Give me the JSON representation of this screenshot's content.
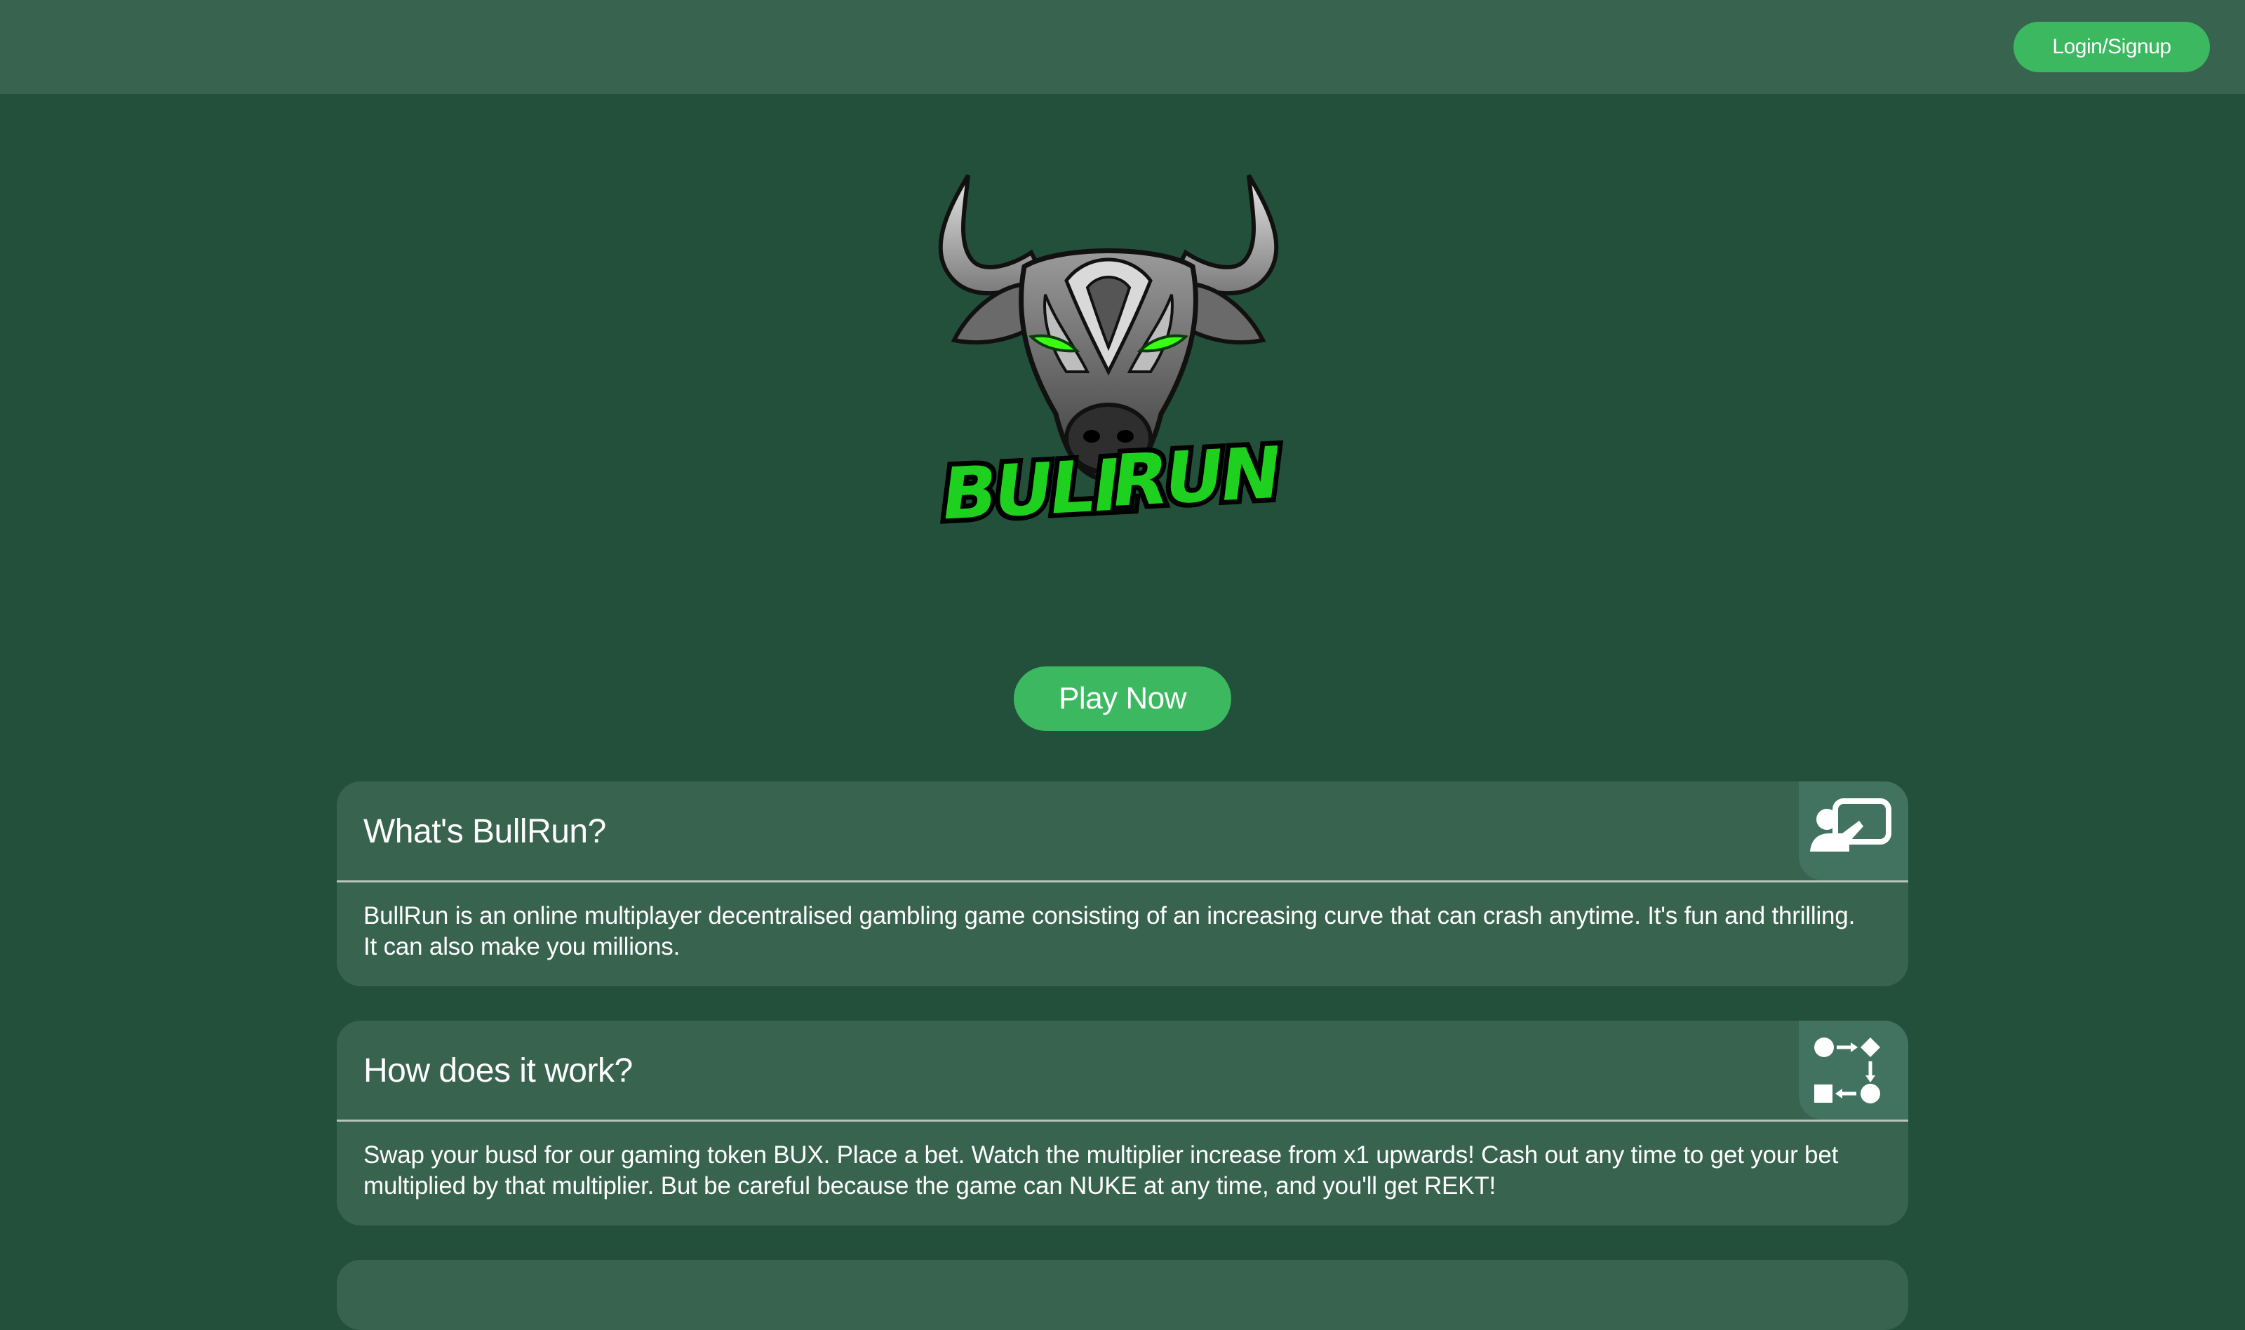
{
  "header": {
    "login_label": "Login/Signup"
  },
  "logo": {
    "text_part1": "BULL",
    "text_part2": "RUN",
    "accent_color": "#1fd11f",
    "eye_color": "#39ff14"
  },
  "hero": {
    "play_label": "Play Now"
  },
  "sections": [
    {
      "title": "What's BullRun?",
      "icon": "presentation-icon",
      "body": "BullRun is an online multiplayer decentralised gambling game consisting of an increasing curve that can crash anytime. It's fun and thrilling. It can also make you millions."
    },
    {
      "title": "How does it work?",
      "icon": "workflow-icon",
      "body": "Swap your busd for our gaming token BUX. Place a bet. Watch the multiplier increase from x1 upwards! Cash out any time to get your bet multiplied by that multiplier. But be careful because the game can NUKE at any time, and you'll get REKT!"
    }
  ],
  "colors": {
    "background": "#22503a",
    "topbar": "#38634f",
    "card": "#38634f",
    "button": "#3cb861"
  }
}
